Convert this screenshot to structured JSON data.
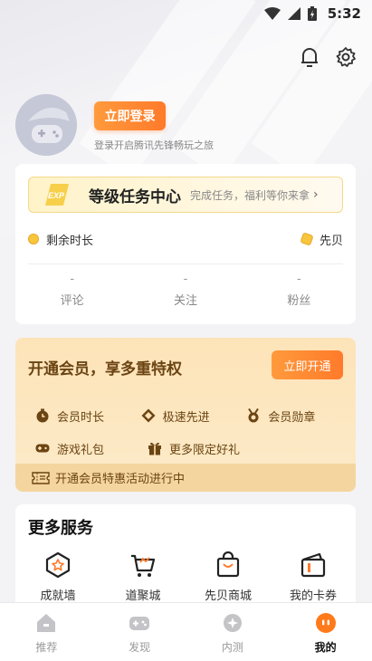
{
  "status_bar": {
    "time": "5:32"
  },
  "profile": {
    "login_button": "立即登录",
    "login_subtitle": "登录开启腾讯先锋畅玩之旅"
  },
  "task_banner": {
    "badge": "EXP",
    "title": "等级任务中心",
    "subtitle": "完成任务，福利等你来拿"
  },
  "balances": {
    "time_left_label": "剩余时长",
    "coins_label": "先贝"
  },
  "stats": [
    {
      "value": "-",
      "label": "评论"
    },
    {
      "value": "-",
      "label": "关注"
    },
    {
      "value": "-",
      "label": "粉丝"
    }
  ],
  "vip": {
    "title": "开通会员，享多重特权",
    "button": "立即开通",
    "perks": [
      "会员时长",
      "极速先进",
      "会员勋章",
      "游戏礼包",
      "更多限定好礼"
    ],
    "footer": "开通会员特惠活动进行中",
    "colors": {
      "accent": "#ff8a33",
      "text": "#6b4413",
      "bg": "#fde3b8"
    }
  },
  "services": {
    "title": "更多服务",
    "items": [
      {
        "label": "成就墙",
        "icon": "achievement-icon"
      },
      {
        "label": "道聚城",
        "icon": "cart-icon"
      },
      {
        "label": "先贝商城",
        "icon": "shopping-bag-icon"
      },
      {
        "label": "我的卡券",
        "icon": "coupon-icon"
      }
    ]
  },
  "bottom_nav": [
    {
      "label": "推荐",
      "icon": "home-icon",
      "active": false
    },
    {
      "label": "发现",
      "icon": "gamepad-icon",
      "active": false
    },
    {
      "label": "内测",
      "icon": "beta-icon",
      "active": false
    },
    {
      "label": "我的",
      "icon": "profile-icon",
      "active": true
    }
  ]
}
